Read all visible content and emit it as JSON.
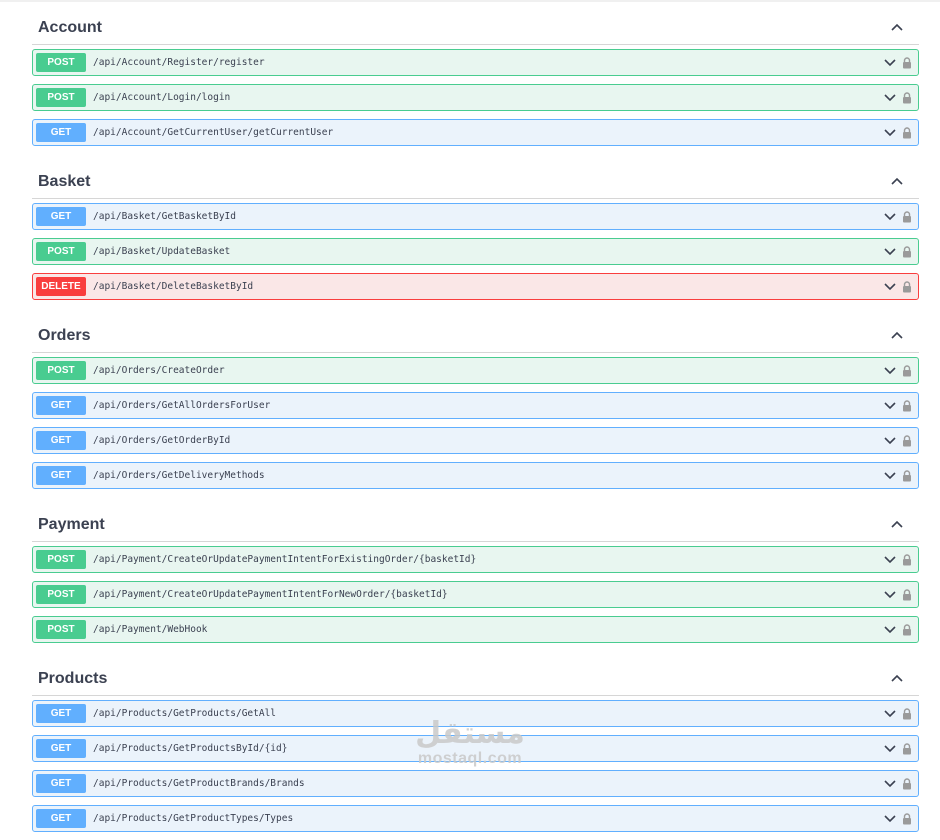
{
  "sections": [
    {
      "title": "Account",
      "operations": [
        {
          "method": "POST",
          "path": "/api/Account/Register/register"
        },
        {
          "method": "POST",
          "path": "/api/Account/Login/login"
        },
        {
          "method": "GET",
          "path": "/api/Account/GetCurrentUser/getCurrentUser"
        }
      ]
    },
    {
      "title": "Basket",
      "operations": [
        {
          "method": "GET",
          "path": "/api/Basket/GetBasketById"
        },
        {
          "method": "POST",
          "path": "/api/Basket/UpdateBasket"
        },
        {
          "method": "DELETE",
          "path": "/api/Basket/DeleteBasketById"
        }
      ]
    },
    {
      "title": "Orders",
      "operations": [
        {
          "method": "POST",
          "path": "/api/Orders/CreateOrder"
        },
        {
          "method": "GET",
          "path": "/api/Orders/GetAllOrdersForUser"
        },
        {
          "method": "GET",
          "path": "/api/Orders/GetOrderById"
        },
        {
          "method": "GET",
          "path": "/api/Orders/GetDeliveryMethods"
        }
      ]
    },
    {
      "title": "Payment",
      "operations": [
        {
          "method": "POST",
          "path": "/api/Payment/CreateOrUpdatePaymentIntentForExistingOrder/{basketId}"
        },
        {
          "method": "POST",
          "path": "/api/Payment/CreateOrUpdatePaymentIntentForNewOrder/{basketId}"
        },
        {
          "method": "POST",
          "path": "/api/Payment/WebHook"
        }
      ]
    },
    {
      "title": "Products",
      "operations": [
        {
          "method": "GET",
          "path": "/api/Products/GetProducts/GetAll"
        },
        {
          "method": "GET",
          "path": "/api/Products/GetProductsById/{id}"
        },
        {
          "method": "GET",
          "path": "/api/Products/GetProductBrands/Brands"
        },
        {
          "method": "GET",
          "path": "/api/Products/GetProductTypes/Types"
        }
      ]
    }
  ],
  "watermark": {
    "arabic": "مستقل",
    "latin": "mostaql.com"
  },
  "colors": {
    "post": "#49cc90",
    "get": "#61affe",
    "delete": "#f93e3e",
    "text": "#3b4151"
  },
  "icons": {
    "section_toggle": "chevron-up-icon",
    "op_expand": "chevron-down-icon",
    "op_auth": "lock-icon"
  }
}
